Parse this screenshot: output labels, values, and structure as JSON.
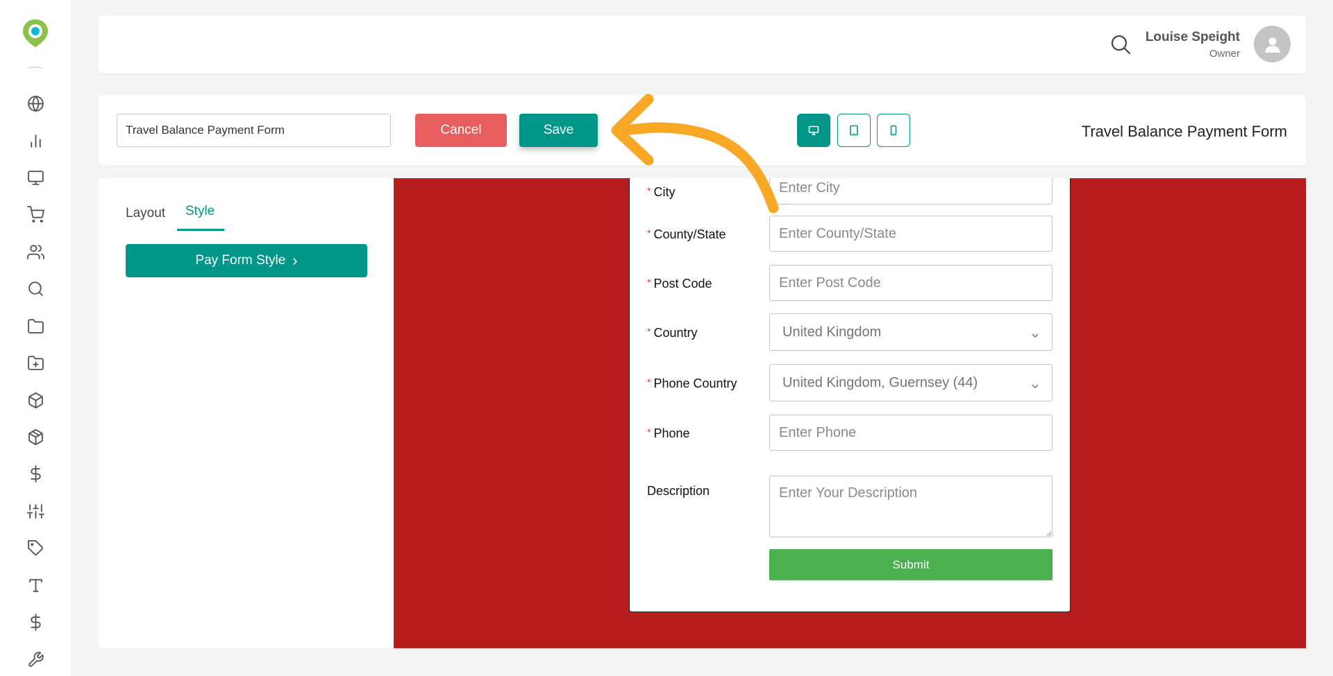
{
  "header": {
    "user_name": "Louise Speight",
    "user_role": "Owner"
  },
  "toolbar": {
    "form_name_value": "Travel Balance Payment Form",
    "cancel_label": "Cancel",
    "save_label": "Save",
    "title": "Travel Balance Payment Form"
  },
  "left_panel": {
    "tabs": [
      {
        "label": "Layout",
        "active": false
      },
      {
        "label": "Style",
        "active": true
      }
    ],
    "pay_form_style_label": "Pay Form Style",
    "chevron": "›"
  },
  "form": {
    "required_mark": "*",
    "fields": [
      {
        "label": "City",
        "placeholder": "Enter City",
        "required": true
      },
      {
        "label": "County/State",
        "placeholder": "Enter County/State",
        "required": true
      },
      {
        "label": "Post Code",
        "placeholder": "Enter Post Code",
        "required": true
      },
      {
        "label": "Country",
        "value": "United Kingdom",
        "required": true
      },
      {
        "label": "Phone Country",
        "value": "United Kingdom, Guernsey (44)",
        "required": true
      },
      {
        "label": "Phone",
        "placeholder": "Enter Phone",
        "required": true
      },
      {
        "label": "Description",
        "placeholder": "Enter Your Description",
        "required": false
      }
    ],
    "submit_label": "Submit"
  },
  "colors": {
    "accent": "#009688",
    "cancel": "#e85d5d",
    "canvas_bg": "#b71c1c",
    "submit": "#4caf50",
    "annotation_arrow": "#f9a825"
  },
  "icons": {
    "sidebar": [
      "globe-icon",
      "bar-chart-icon",
      "monitor-icon",
      "cart-icon",
      "users-icon",
      "search-icon",
      "folder-icon",
      "folder-plus-icon",
      "box-icon",
      "package-icon",
      "dollar-icon",
      "sliders-icon",
      "tag-icon",
      "type-icon",
      "dollar-icon",
      "wrench-icon"
    ],
    "devices": [
      "desktop-icon",
      "tablet-icon",
      "mobile-icon"
    ]
  }
}
